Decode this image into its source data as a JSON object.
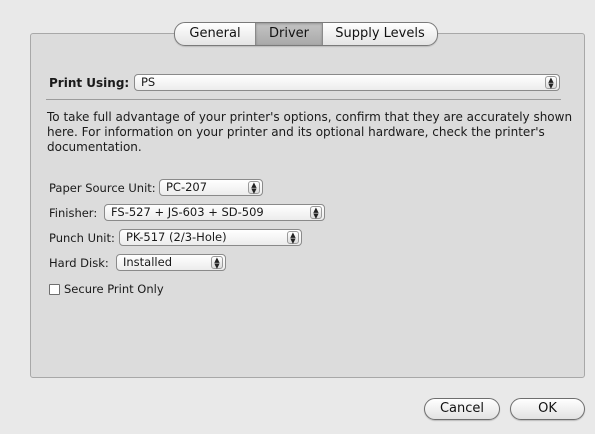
{
  "tabs": [
    {
      "label": "General",
      "active": false
    },
    {
      "label": "Driver",
      "active": true
    },
    {
      "label": "Supply Levels",
      "active": false
    }
  ],
  "print_using": {
    "label": "Print Using:",
    "value": "PS"
  },
  "info_lines": [
    "To take full advantage of your printer's options, confirm that they are accurately shown",
    "here. For information on your printer and its optional hardware, check the printer's",
    "documentation."
  ],
  "options": {
    "paper_source": {
      "label": "Paper Source Unit:",
      "value": "PC-207"
    },
    "finisher": {
      "label": "Finisher:",
      "value": "FS-527 + JS-603 + SD-509"
    },
    "punch_unit": {
      "label": "Punch Unit:",
      "value": "PK-517 (2/3-Hole)"
    },
    "hard_disk": {
      "label": "Hard Disk:",
      "value": "Installed"
    }
  },
  "secure_print": {
    "label": "Secure Print Only",
    "checked": false
  },
  "buttons": {
    "cancel": "Cancel",
    "ok": "OK"
  },
  "icons": {
    "stepper": "up-down-arrows-icon",
    "stepper_glyph": "▲▼"
  }
}
